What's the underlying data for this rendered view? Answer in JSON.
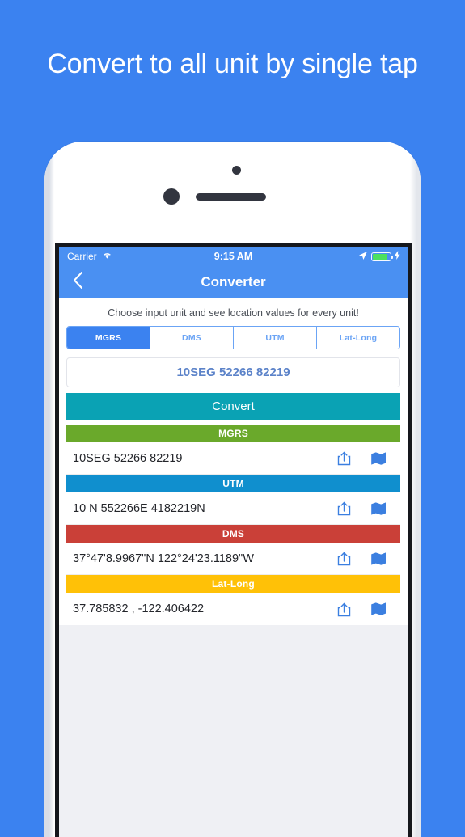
{
  "headline": "Convert to all unit by single tap",
  "statusbar": {
    "carrier": "Carrier",
    "wifi_icon": "wifi-icon",
    "time": "9:15 AM",
    "location_icon": "location-arrow-icon",
    "battery_icon": "battery-icon",
    "charging_icon": "lightning-bolt-icon"
  },
  "navbar": {
    "back_icon": "chevron-left-icon",
    "title": "Converter"
  },
  "main": {
    "hint": "Choose input unit and see location values for every unit!",
    "segments": [
      {
        "label": "MGRS",
        "selected": true
      },
      {
        "label": "DMS",
        "selected": false
      },
      {
        "label": "UTM",
        "selected": false
      },
      {
        "label": "Lat-Long",
        "selected": false
      }
    ],
    "input_value": "10SEG 52266 82219",
    "convert_label": "Convert",
    "results": [
      {
        "header": "MGRS",
        "color": "#6aa92b",
        "value": "10SEG 52266 82219"
      },
      {
        "header": "UTM",
        "color": "#108fce",
        "value": "10 N 552266E 4182219N"
      },
      {
        "header": "DMS",
        "color": "#ca4038",
        "value": "37°47'8.9967\"N 122°24'23.1189\"W"
      },
      {
        "header": "Lat-Long",
        "color": "#ffc107",
        "value": "37.785832 , -122.406422"
      }
    ],
    "share_icon": "share-icon",
    "map_icon": "map-icon"
  },
  "colors": {
    "brand_blue": "#3b82f0",
    "status_blue": "#4a90f2",
    "convert_teal": "#0aa2b4",
    "icon_blue": "#3b7fe0"
  }
}
